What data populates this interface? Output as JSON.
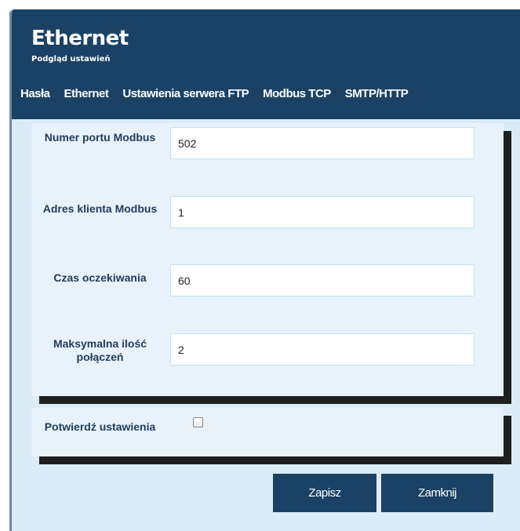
{
  "header": {
    "title": "Ethernet",
    "subtitle": "Podgląd ustawień"
  },
  "tabs": [
    {
      "label": "Hasła"
    },
    {
      "label": "Ethernet"
    },
    {
      "label": "Ustawienia serwera FTP"
    },
    {
      "label": "Modbus TCP"
    },
    {
      "label": "SMTP/HTTP"
    }
  ],
  "form": {
    "fields": [
      {
        "label": "Numer portu Modbus",
        "value": "502"
      },
      {
        "label": "Adres klienta Modbus",
        "value": "1"
      },
      {
        "label": "Czas oczekiwania",
        "value": "60"
      },
      {
        "label": "Maksymalna ilość połączeń",
        "value": "2"
      }
    ]
  },
  "confirm": {
    "label": "Potwierdź ustawienia",
    "checked": false
  },
  "buttons": {
    "save": "Zapisz",
    "close": "Zamknij"
  },
  "colors": {
    "header": "#1b4265",
    "panel": "#e8f2fa",
    "background": "#dcecf7",
    "label_text": "#1f3c5a"
  }
}
